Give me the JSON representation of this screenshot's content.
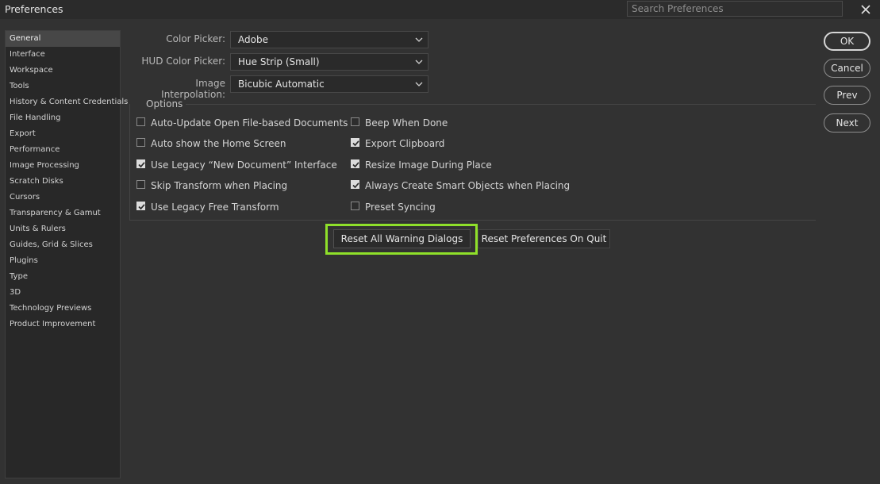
{
  "window": {
    "title": "Preferences",
    "search_placeholder": "Search Preferences",
    "close_icon": "close-icon"
  },
  "sidebar": {
    "items": [
      {
        "label": "General",
        "active": true
      },
      {
        "label": "Interface"
      },
      {
        "label": "Workspace"
      },
      {
        "label": "Tools"
      },
      {
        "label": "History & Content Credentials"
      },
      {
        "label": "File Handling"
      },
      {
        "label": "Export"
      },
      {
        "label": "Performance"
      },
      {
        "label": "Image Processing"
      },
      {
        "label": "Scratch Disks"
      },
      {
        "label": "Cursors"
      },
      {
        "label": "Transparency & Gamut"
      },
      {
        "label": "Units & Rulers"
      },
      {
        "label": "Guides, Grid & Slices"
      },
      {
        "label": "Plugins"
      },
      {
        "label": "Type"
      },
      {
        "label": "3D"
      },
      {
        "label": "Technology Previews"
      },
      {
        "label": "Product Improvement"
      }
    ]
  },
  "general": {
    "color_picker": {
      "label": "Color Picker:",
      "value": "Adobe"
    },
    "hud_color_picker": {
      "label": "HUD Color Picker:",
      "value": "Hue Strip (Small)"
    },
    "image_interpolation": {
      "label": "Image Interpolation:",
      "value": "Bicubic Automatic"
    },
    "options": {
      "legend": "Options",
      "left": [
        {
          "label": "Auto-Update Open File-based Documents",
          "checked": false
        },
        {
          "label": "Auto show the Home Screen",
          "checked": false
        },
        {
          "label": "Use Legacy “New Document” Interface",
          "checked": true
        },
        {
          "label": "Skip Transform when Placing",
          "checked": false
        },
        {
          "label": "Use Legacy Free Transform",
          "checked": true
        }
      ],
      "right": [
        {
          "label": "Beep When Done",
          "checked": false
        },
        {
          "label": "Export Clipboard",
          "checked": true
        },
        {
          "label": "Resize Image During Place",
          "checked": true
        },
        {
          "label": "Always Create Smart Objects when Placing",
          "checked": true
        },
        {
          "label": "Preset Syncing",
          "checked": false
        }
      ]
    },
    "reset_warning_label": "Reset All Warning Dialogs",
    "reset_prefs_label": "Reset Preferences On Quit"
  },
  "buttons": {
    "ok": "OK",
    "cancel": "Cancel",
    "prev": "Prev",
    "next": "Next"
  },
  "colors": {
    "highlight": "#8fe02a",
    "background": "#323232",
    "sidebar_active": "#474747"
  }
}
